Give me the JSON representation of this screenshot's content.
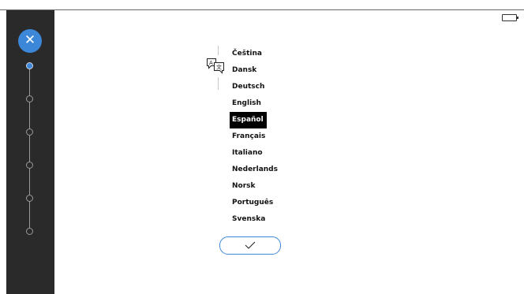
{
  "sidebar": {
    "close_icon": "close-icon",
    "steps": [
      {
        "active": true
      },
      {
        "active": false
      },
      {
        "active": false
      },
      {
        "active": false
      },
      {
        "active": false
      },
      {
        "active": false
      }
    ]
  },
  "language_icon": "translate-icon",
  "languages": [
    {
      "label": "Čeština",
      "selected": false
    },
    {
      "label": "Dansk",
      "selected": false
    },
    {
      "label": "Deutsch",
      "selected": false
    },
    {
      "label": "English",
      "selected": false
    },
    {
      "label": "Español",
      "selected": true
    },
    {
      "label": "Français",
      "selected": false
    },
    {
      "label": "Italiano",
      "selected": false
    },
    {
      "label": "Nederlands",
      "selected": false
    },
    {
      "label": "Norsk",
      "selected": false
    },
    {
      "label": "Português",
      "selected": false
    },
    {
      "label": "Svenska",
      "selected": false
    }
  ],
  "confirm_icon": "checkmark-icon",
  "status": {
    "battery_icon": "battery-icon"
  },
  "colors": {
    "accent": "#3d87d8",
    "sidebar": "#2a2a2a",
    "selected_bg": "#000000"
  }
}
